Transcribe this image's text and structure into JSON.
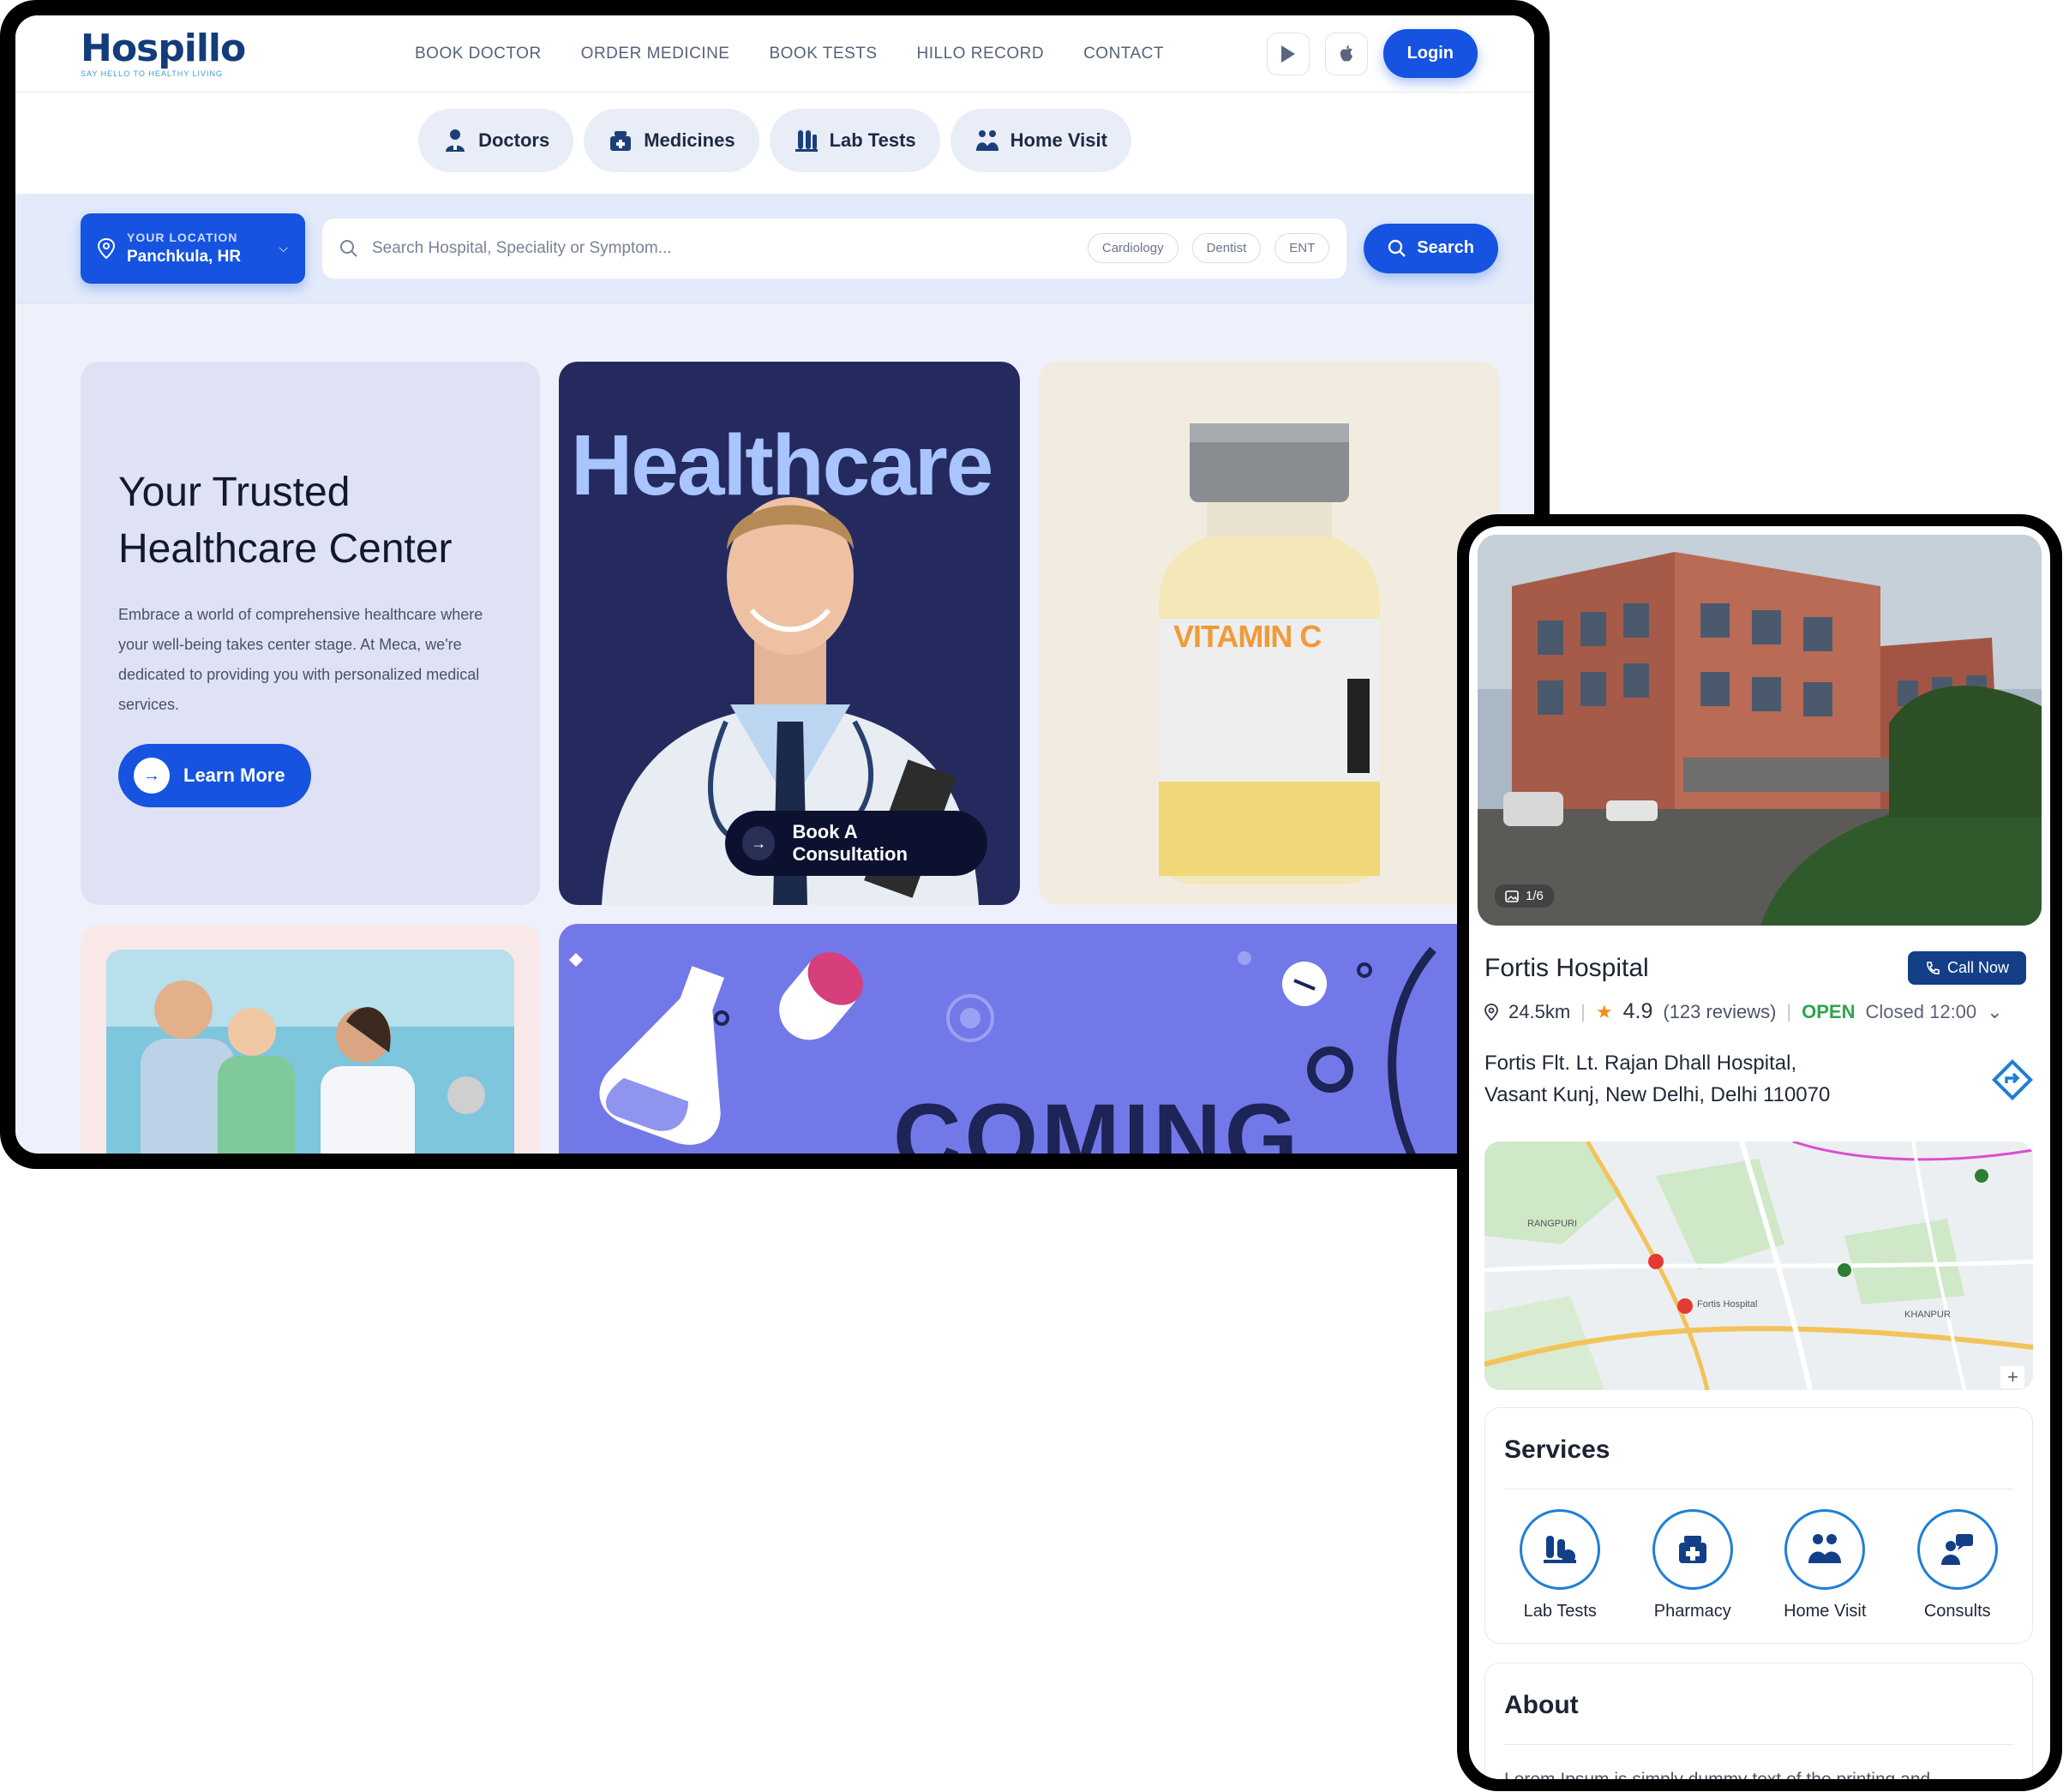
{
  "brand": {
    "logo": "Hospillo",
    "tagline": "SAY HELLO TO HEALTHY LIVING",
    "accent": "#1553e0",
    "navy": "#123f86"
  },
  "nav": {
    "links": [
      "BOOK DOCTOR",
      "ORDER MEDICINE",
      "BOOK TESTS",
      "HILLO RECORD",
      "CONTACT"
    ],
    "login": "Login"
  },
  "categories": [
    {
      "label": "Doctors",
      "icon": "doctor-icon"
    },
    {
      "label": "Medicines",
      "icon": "medicine-icon"
    },
    {
      "label": "Lab Tests",
      "icon": "lab-icon"
    },
    {
      "label": "Home Visit",
      "icon": "home-visit-icon"
    }
  ],
  "search": {
    "location_label": "YOUR LOCATION",
    "location_value": "Panchkula, HR",
    "placeholder": "Search Hospital, Speciality or Symptom...",
    "chips": [
      "Cardiology",
      "Dentist",
      "ENT"
    ],
    "button": "Search"
  },
  "hero": {
    "title_line1": "Your Trusted",
    "title_line2": "Healthcare Center",
    "description": "Embrace a world of comprehensive healthcare where your well-being takes center stage. At Meca, we're dedicated to providing you with personalized medical services.",
    "cta": "Learn More"
  },
  "doctor_card": {
    "heading": "Healthcare",
    "cta": "Book A Consultation"
  },
  "vitamin_card": {
    "label": "VITAMIN C"
  },
  "coming_card": {
    "text": "COMING"
  },
  "hospital": {
    "photo_counter": "1/6",
    "name": "Fortis Hospital",
    "call": "Call Now",
    "distance": "24.5km",
    "rating": "4.9",
    "reviews": "(123 reviews)",
    "status": "OPEN",
    "hours": "Closed 12:00",
    "address_line1": "Fortis Flt. Lt. Rajan Dhall Hospital,",
    "address_line2": "Vasant Kunj, New Delhi, Delhi 110070"
  },
  "map_labels": {
    "area_left": "RANGPURI",
    "fortis_pin": "Fortis Hospital",
    "khanpur": "KHANPUR"
  },
  "services": {
    "title": "Services",
    "items": [
      {
        "label": "Lab Tests",
        "icon": "lab-tests-icon"
      },
      {
        "label": "Pharmacy",
        "icon": "pharmacy-icon"
      },
      {
        "label": "Home Visit",
        "icon": "home-visit-icon"
      },
      {
        "label": "Consults",
        "icon": "consults-icon"
      }
    ]
  },
  "about": {
    "title": "About",
    "text": "Lorem Ipsum is simply dummy text of the printing and"
  }
}
